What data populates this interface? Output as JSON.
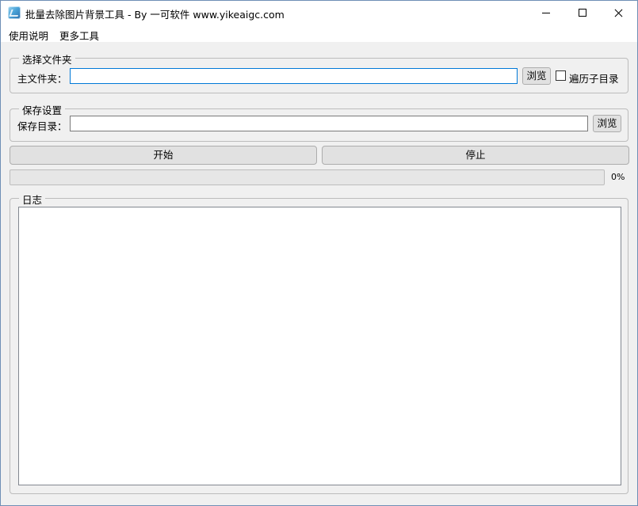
{
  "window": {
    "title": "批量去除图片背景工具 - By 一可软件 www.yikeaigc.com"
  },
  "menu": {
    "items": [
      "使用说明",
      "更多工具"
    ]
  },
  "select_folder": {
    "group_title": "选择文件夹",
    "main_folder_label": "主文件夹：",
    "main_folder_value": "",
    "browse_label": "浏览",
    "recursive_label": "遍历子目录",
    "recursive_checked": false
  },
  "save_settings": {
    "group_title": "保存设置",
    "save_dir_label": "保存目录：",
    "save_dir_value": "",
    "browse_label": "浏览"
  },
  "actions": {
    "start_label": "开始",
    "stop_label": "停止"
  },
  "progress": {
    "value": 0,
    "text": "0%",
    "fill_color": "#06b025"
  },
  "log": {
    "group_title": "日志",
    "content": ""
  }
}
